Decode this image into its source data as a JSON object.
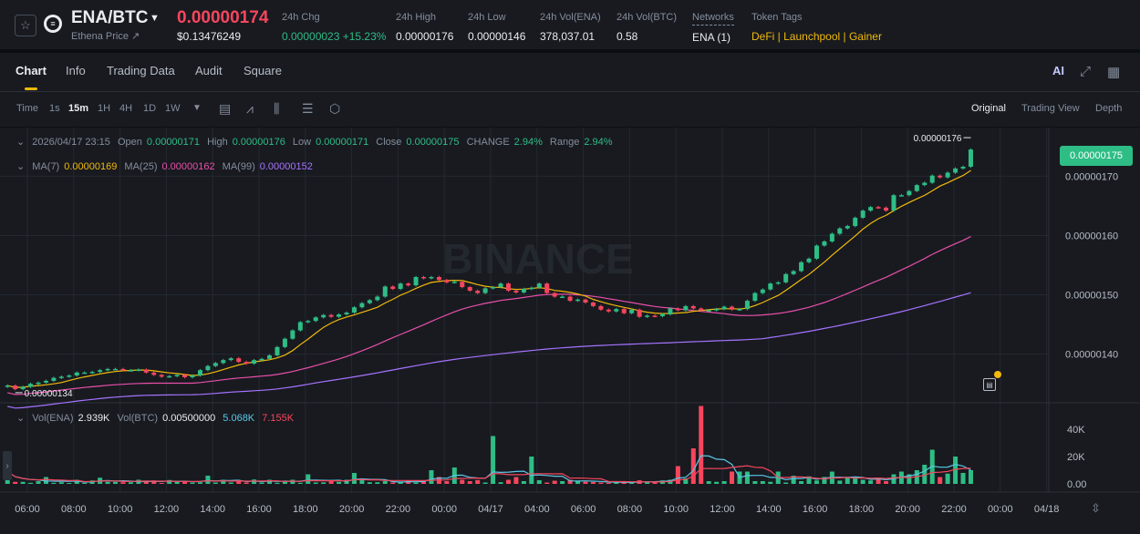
{
  "header": {
    "pair": "ENA/BTC",
    "subtitle": "Ethena Price ↗",
    "last_price": "0.00000174",
    "usd_price": "$0.13476249",
    "stats": [
      {
        "label": "24h Chg",
        "value": "0.00000023 +15.23%",
        "color": "green"
      },
      {
        "label": "24h High",
        "value": "0.00000176"
      },
      {
        "label": "24h Low",
        "value": "0.00000146"
      },
      {
        "label": "24h Vol(ENA)",
        "value": "378,037.01"
      },
      {
        "label": "24h Vol(BTC)",
        "value": "0.58"
      },
      {
        "label": "Networks",
        "value": "ENA (1)"
      },
      {
        "label": "Token Tags",
        "value": "DeFi | Launchpool | Gainer",
        "color": "yellow"
      }
    ]
  },
  "tabs": [
    {
      "label": "Chart",
      "active": true
    },
    {
      "label": "Info"
    },
    {
      "label": "Trading Data"
    },
    {
      "label": "Audit"
    },
    {
      "label": "Square"
    }
  ],
  "toolbar": {
    "timeframes": [
      "Time",
      "1s",
      "15m",
      "1H",
      "4H",
      "1D",
      "1W"
    ],
    "selected_timeframe": "15m",
    "views": [
      "Original",
      "Trading View",
      "Depth"
    ],
    "selected_view": "Original",
    "icons": [
      "dropdown-caret-icon",
      "calendar-icon",
      "indicator-icon",
      "candle-type-icon",
      "settings-icon",
      "hexagon-settings-icon"
    ]
  },
  "ohlc": {
    "datetime": "2026/04/17 23:15",
    "open_label": "Open",
    "open": "0.00000171",
    "high_label": "High",
    "high": "0.00000176",
    "low_label": "Low",
    "low": "0.00000171",
    "close_label": "Close",
    "close": "0.00000175",
    "change_label": "CHANGE",
    "change": "2.94%",
    "range_label": "Range",
    "range": "2.94%"
  },
  "ma": {
    "ma7_label": "MA(7)",
    "ma7": "0.00000169",
    "ma25_label": "MA(25)",
    "ma25": "0.00000162",
    "ma99_label": "MA(99)",
    "ma99": "0.00000152"
  },
  "volume": {
    "vol_ena_label": "Vol(ENA)",
    "vol_ena": "2.939K",
    "vol_btc_label": "Vol(BTC)",
    "vol_btc": "0.00500000",
    "ma5": "5.068K",
    "ma10": "7.155K"
  },
  "price_badge": "0.00000175",
  "high_marker": "0.00000176",
  "low_marker": "0.00000134",
  "watermark": "BINANCE",
  "colors": {
    "up": "#2ebd85",
    "down": "#f6465d",
    "ma7": "#f0b90b",
    "ma25": "#e84fa9",
    "ma99": "#a673ff",
    "vol_ma5": "#5ac8e6",
    "vol_ma10": "#f6465d",
    "accent": "#f0b90b"
  },
  "chart_data": {
    "type": "line",
    "title": "",
    "y_ticks": [
      "0.00000170",
      "0.00000160",
      "0.00000150",
      "0.00000140"
    ],
    "y_tick_values": [
      1.7,
      1.6,
      1.5,
      1.4
    ],
    "ylim": [
      1.318,
      1.782
    ],
    "x_ticks": [
      "06:00",
      "08:00",
      "10:00",
      "12:00",
      "14:00",
      "16:00",
      "18:00",
      "20:00",
      "22:00",
      "00:00",
      "04/17",
      "04:00",
      "06:00",
      "08:00",
      "10:00",
      "12:00",
      "14:00",
      "16:00",
      "18:00",
      "20:00",
      "22:00",
      "00:00",
      "04/18"
    ],
    "vol_ticks": [
      "40K",
      "20K",
      "0.00"
    ],
    "vol_tick_values": [
      40000,
      20000,
      0
    ],
    "vol_ylim": [
      0,
      60000
    ],
    "close_series": [
      1.347,
      1.341,
      1.345,
      1.35,
      1.352,
      1.355,
      1.36,
      1.362,
      1.364,
      1.369,
      1.369,
      1.37,
      1.373,
      1.375,
      1.375,
      1.373,
      1.373,
      1.374,
      1.369,
      1.365,
      1.362,
      1.363,
      1.365,
      1.361,
      1.364,
      1.373,
      1.38,
      1.385,
      1.39,
      1.393,
      1.387,
      1.384,
      1.39,
      1.392,
      1.398,
      1.412,
      1.426,
      1.44,
      1.454,
      1.456,
      1.462,
      1.466,
      1.463,
      1.467,
      1.47,
      1.479,
      1.486,
      1.491,
      1.497,
      1.514,
      1.51,
      1.519,
      1.516,
      1.53,
      1.528,
      1.53,
      1.525,
      1.521,
      1.522,
      1.513,
      1.507,
      1.503,
      1.511,
      1.513,
      1.519,
      1.507,
      1.504,
      1.51,
      1.512,
      1.519,
      1.503,
      1.497,
      1.497,
      1.49,
      1.492,
      1.487,
      1.481,
      1.475,
      1.472,
      1.476,
      1.469,
      1.475,
      1.463,
      1.465,
      1.464,
      1.467,
      1.477,
      1.474,
      1.481,
      1.477,
      1.474,
      1.474,
      1.476,
      1.48,
      1.475,
      1.476,
      1.49,
      1.503,
      1.509,
      1.519,
      1.521,
      1.535,
      1.54,
      1.555,
      1.561,
      1.583,
      1.59,
      1.603,
      1.612,
      1.616,
      1.63,
      1.642,
      1.648,
      1.647,
      1.642,
      1.668,
      1.668,
      1.675,
      1.685,
      1.689,
      1.701,
      1.698,
      1.706,
      1.713,
      1.716,
      1.745
    ],
    "volume_series": [
      9000,
      1500,
      1500,
      800,
      2000,
      5000,
      800,
      1200,
      500,
      3000,
      600,
      2500,
      4500,
      1500,
      1500,
      1200,
      1200,
      3000,
      1500,
      2500,
      500,
      2800,
      2000,
      1800,
      900,
      1200,
      6000,
      1000,
      3000,
      1000,
      2200,
      1000,
      3200,
      1000,
      3000,
      800,
      2000,
      3000,
      800,
      7000,
      1000,
      1100,
      2800,
      1500,
      3000,
      8000,
      3000,
      1200,
      1200,
      2000,
      1000,
      1200,
      2600,
      1000,
      2500,
      10000,
      5000,
      2000,
      12000,
      3000,
      2000,
      2800,
      1000,
      35000,
      1200,
      3000,
      5000,
      2000,
      20000,
      2700,
      1000,
      2300,
      2000,
      3000,
      2000,
      1600,
      1400,
      1000,
      800,
      1300,
      1200,
      1200,
      2600,
      1400,
      1500,
      2500,
      3000,
      13000,
      4000,
      26000,
      57000,
      2000,
      1500,
      2000,
      9000,
      9000,
      9000,
      2000,
      2000,
      1500,
      9000,
      1000,
      6000,
      2000,
      5500,
      2500,
      5000,
      9000,
      2400,
      4800,
      4000,
      3000,
      2500,
      4000,
      2000,
      7000,
      9000,
      7000,
      10000,
      14000,
      25000,
      5000,
      7500,
      20000,
      8000,
      10000
    ]
  }
}
